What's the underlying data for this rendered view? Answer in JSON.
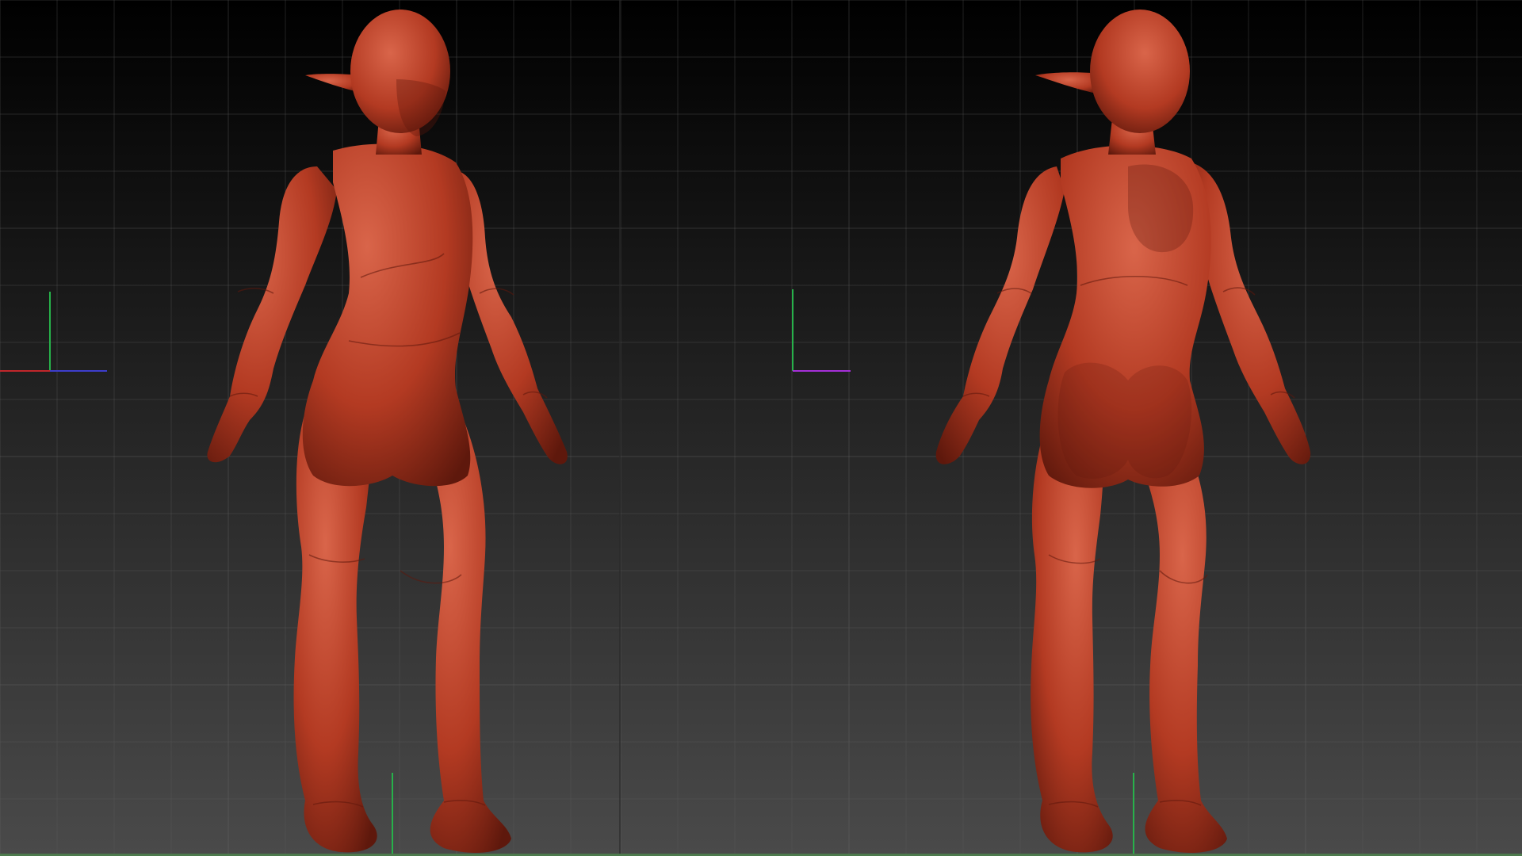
{
  "app": {
    "type": "3d-sculpting-viewport",
    "layout": "dual-viewport"
  },
  "theme": {
    "background_top": "#000000",
    "background_bottom": "#4a4a4a",
    "grid_line": "#5c5c5c",
    "grid_major": "#6e6e6e",
    "model_base": "#b33a22",
    "model_light": "#d9654a",
    "model_shadow": "#5e180c",
    "axis_x": "#c0262b",
    "axis_y": "#27b14a",
    "axis_z": "#3d3dcc",
    "axis_z_alt": "#a52fd8",
    "floor_edge": "#4d7a4d"
  },
  "viewports": [
    {
      "id": "front",
      "view": "front-three-quarter",
      "model": "humanoid-elf-figure",
      "icons": [
        "axis-gizmo-icon",
        "floor-grid-icon"
      ]
    },
    {
      "id": "back",
      "view": "back-three-quarter",
      "model": "humanoid-elf-figure",
      "icons": [
        "axis-gizmo-icon",
        "floor-grid-icon"
      ]
    }
  ]
}
